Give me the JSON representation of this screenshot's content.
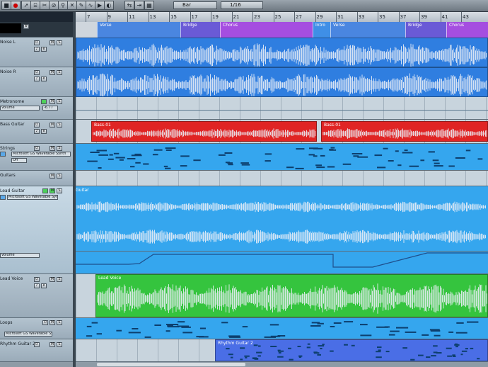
{
  "toolbar": {
    "snap_mode": "Bar",
    "quantize": "1/16"
  },
  "ruler": {
    "bars": [
      "7",
      "9",
      "11",
      "13",
      "15",
      "17",
      "19",
      "21",
      "23",
      "25",
      "27",
      "29",
      "31",
      "33",
      "35",
      "37",
      "39",
      "41",
      "43"
    ]
  },
  "markers": [
    {
      "label": "Verse",
      "color": "#4a86e0"
    },
    {
      "label": "Bridge",
      "color": "#6a5ad6"
    },
    {
      "label": "Chorus",
      "color": "#a54ee0"
    },
    {
      "label": "Intro",
      "color": "#3f8fe6"
    },
    {
      "label": "Verse",
      "color": "#4a86e0"
    },
    {
      "label": "Bridge",
      "color": "#6a5ad6"
    },
    {
      "label": "Chorus",
      "color": "#a54ee0"
    }
  ],
  "tracks": [
    {
      "name": "Noise L"
    },
    {
      "name": "Noise R"
    },
    {
      "name": "Metronome",
      "param": "Volume",
      "value": "-6.77"
    },
    {
      "name": "Bass Guitar"
    },
    {
      "name": "Strings",
      "instrument": "Microsoft GS Wavetable Synth",
      "slot2": "Off"
    },
    {
      "name": "Guitars"
    },
    {
      "name": "Lead Guitar",
      "instrument": "Microsoft GS Wavetable Synth",
      "param": "Volume"
    },
    {
      "name": "Lead Voice"
    },
    {
      "name": "Loops",
      "instrument": "Microsoft GS Wavetable Synth"
    },
    {
      "name": "Rhythm Guitar 2"
    }
  ],
  "clips": {
    "bass_a": "Bass-01",
    "bass_b": "Bass-01",
    "guitar": "Guitar",
    "lead_voice": "Lead Voice",
    "rhythm": "Rhythm Guitar 2"
  },
  "colors": {
    "audio_blue": "#2f7ee0",
    "bass_red": "#e02424",
    "strings_blue": "#35a6ee",
    "lead_green": "#35c43e",
    "rhythm_blue": "#4a6ee6"
  }
}
